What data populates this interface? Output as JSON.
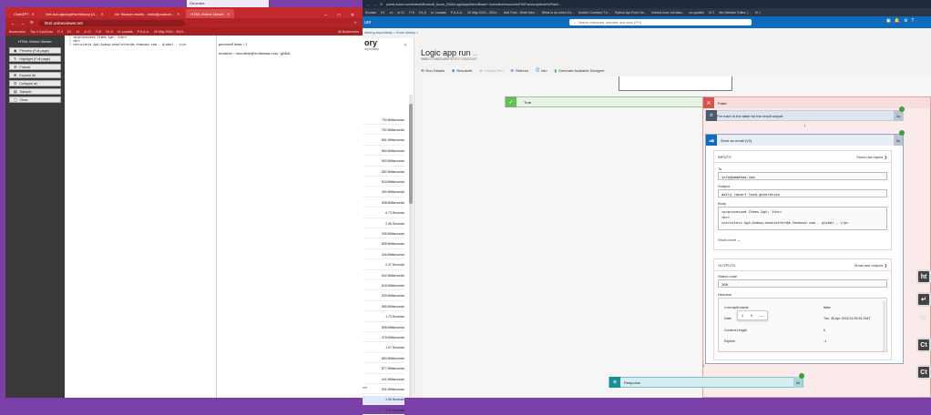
{
  "left_browser": {
    "tabs": [
      "ChatGPT",
      "Get-AzLogicAppRunHistory (A...",
      "r/d: Search results - ololo@product...",
      "HTML Online Viewer"
    ],
    "address": "html.onlineviewer.net",
    "bookmarks": [
      "Bookmarks",
      "Top 3 CyclCraw",
      "R X",
      "E1",
      "x1",
      "ol 21",
      "Π 8",
      "O1-8",
      "r4 .cuartas",
      "P.A.A.A.",
      "30 May 2024 - 2024...",
      "All Bookmarks"
    ],
    "sidebar_title": "HTML Online Viewer",
    "sidebar_buttons": [
      "Preview (Full page)",
      "Highlight (Full page)",
      "Format",
      "Expand all",
      "Collapse all",
      "Sample",
      "Clear"
    ],
    "editor_lines": [
      {
        "n": "1",
        "text": "<p>processed Items &gt; 1<br>"
      },
      {
        "n": "2",
        "text": "<br>"
      },
      {
        "n": "3",
        "text": "recruiters &gt;&nbsp;newsletter@m.themuse.com - global , </p>"
      }
    ],
    "preview_lines": [
      "processed items > 1",
      "recruiters > newsletter@m.themuse.com - global ,"
    ]
  },
  "top_overlay": {
    "title": "Generate"
  },
  "azure": {
    "tabs_strip": [
      "portal.azure.com/#view/Microsoft_Azure_EMA/LogicAppsMenuBlade/~/overview/resourceId/%2Fsubscriptions%2Fab4..."
    ],
    "bookmarks": [
      "Ecolare",
      "E1",
      "x1",
      "ol 21",
      "Π 8",
      "O1-8",
      "r4 .cuartas",
      "P.A.A.A.",
      "30 May 2024 - 2024...",
      "Add Post - Write blee...",
      "What to do when Fa...",
      "Andere Contract T.e...",
      "Python Api From Ou...",
      "Indeed  scan full data...",
      "co.opdatin",
      "IX 2",
      "Mo Website Editor |...",
      "IX 1"
    ],
    "brand": "ure",
    "search_placeholder": "Search resources, services, and docs (G+/)",
    "breadcrumb": "ntering-reportdaily  >  Runs history  >",
    "history_title": "ory",
    "history_sub": "reportdaily",
    "history_rows": [
      "794 Milliseconds",
      "752 Milliseconds",
      "561 Milliseconds",
      "560 Milliseconds",
      "540 Milliseconds",
      "682 Milliseconds",
      "515 Milliseconds",
      "494 Milliseconds",
      "538 Milliseconds",
      "6.73 Seconds",
      "2.36 Seconds",
      "536 Milliseconds",
      "805 Milliseconds",
      "446 Milliseconds",
      "2.47 Seconds",
      "542 Milliseconds",
      "618 Milliseconds",
      "539 Milliseconds",
      "565 Milliseconds",
      "1.73 Seconds",
      "898 Milliseconds",
      "478 Milliseconds",
      "1.07 Seconds",
      "650 Milliseconds",
      "577 Milliseconds",
      "441 Milliseconds",
      "531 Milliseconds",
      "1.94 Seconds",
      "2.15 Seconds"
    ],
    "history_more": "ore",
    "run_title": "Logic app run",
    "run_ellipsis": "...",
    "run_id": "08584171968324469787971773331CU07",
    "toolbar": [
      "Run Details",
      "Resubmit",
      "Cancel Run",
      "Refresh",
      "Info",
      "Generate Available Designer"
    ],
    "true_label": "True",
    "false_label": "False",
    "foreach": {
      "label": "For each in the table for the result output",
      "duration": "1s"
    },
    "send_email": {
      "label": "Send an email (V2)",
      "duration": "0s",
      "inputs_header": "INPUTS",
      "show_inputs": "Show raw inputs",
      "to_label": "To",
      "to_value": "info@pmmakaa.com",
      "subject_label": "Subject",
      "subject_value": "daily report lead generation",
      "body_label": "Body",
      "body_lines": [
        "<p>processed Items &gt; 1<br>",
        "<br>",
        "recruiters &gt;&nbsp;newsletter@m.themuse.com - global , </p>"
      ],
      "show_more": "Show more",
      "outputs_header": "OUTPUTS",
      "show_outputs": "Show raw outputs",
      "status_label": "Status code",
      "status_value": "200",
      "headers_label": "Headers",
      "header_rows": [
        {
          "k": "x-ms-apih-cache",
          "v": "false"
        },
        {
          "k": "Date",
          "v": "Tue, 30 Apr 2024 01:05:34 GMT"
        },
        {
          "k": "Content-Length",
          "v": "0"
        },
        {
          "k": "Expires",
          "v": "-1"
        }
      ],
      "zoom_popup": [
        "1",
        "0",
        "—"
      ]
    },
    "response": {
      "label": "Response",
      "duration": "0s"
    }
  },
  "right_clip": [
    "ht",
    "↵",
    "[C",
    "Ct",
    "Ct"
  ]
}
